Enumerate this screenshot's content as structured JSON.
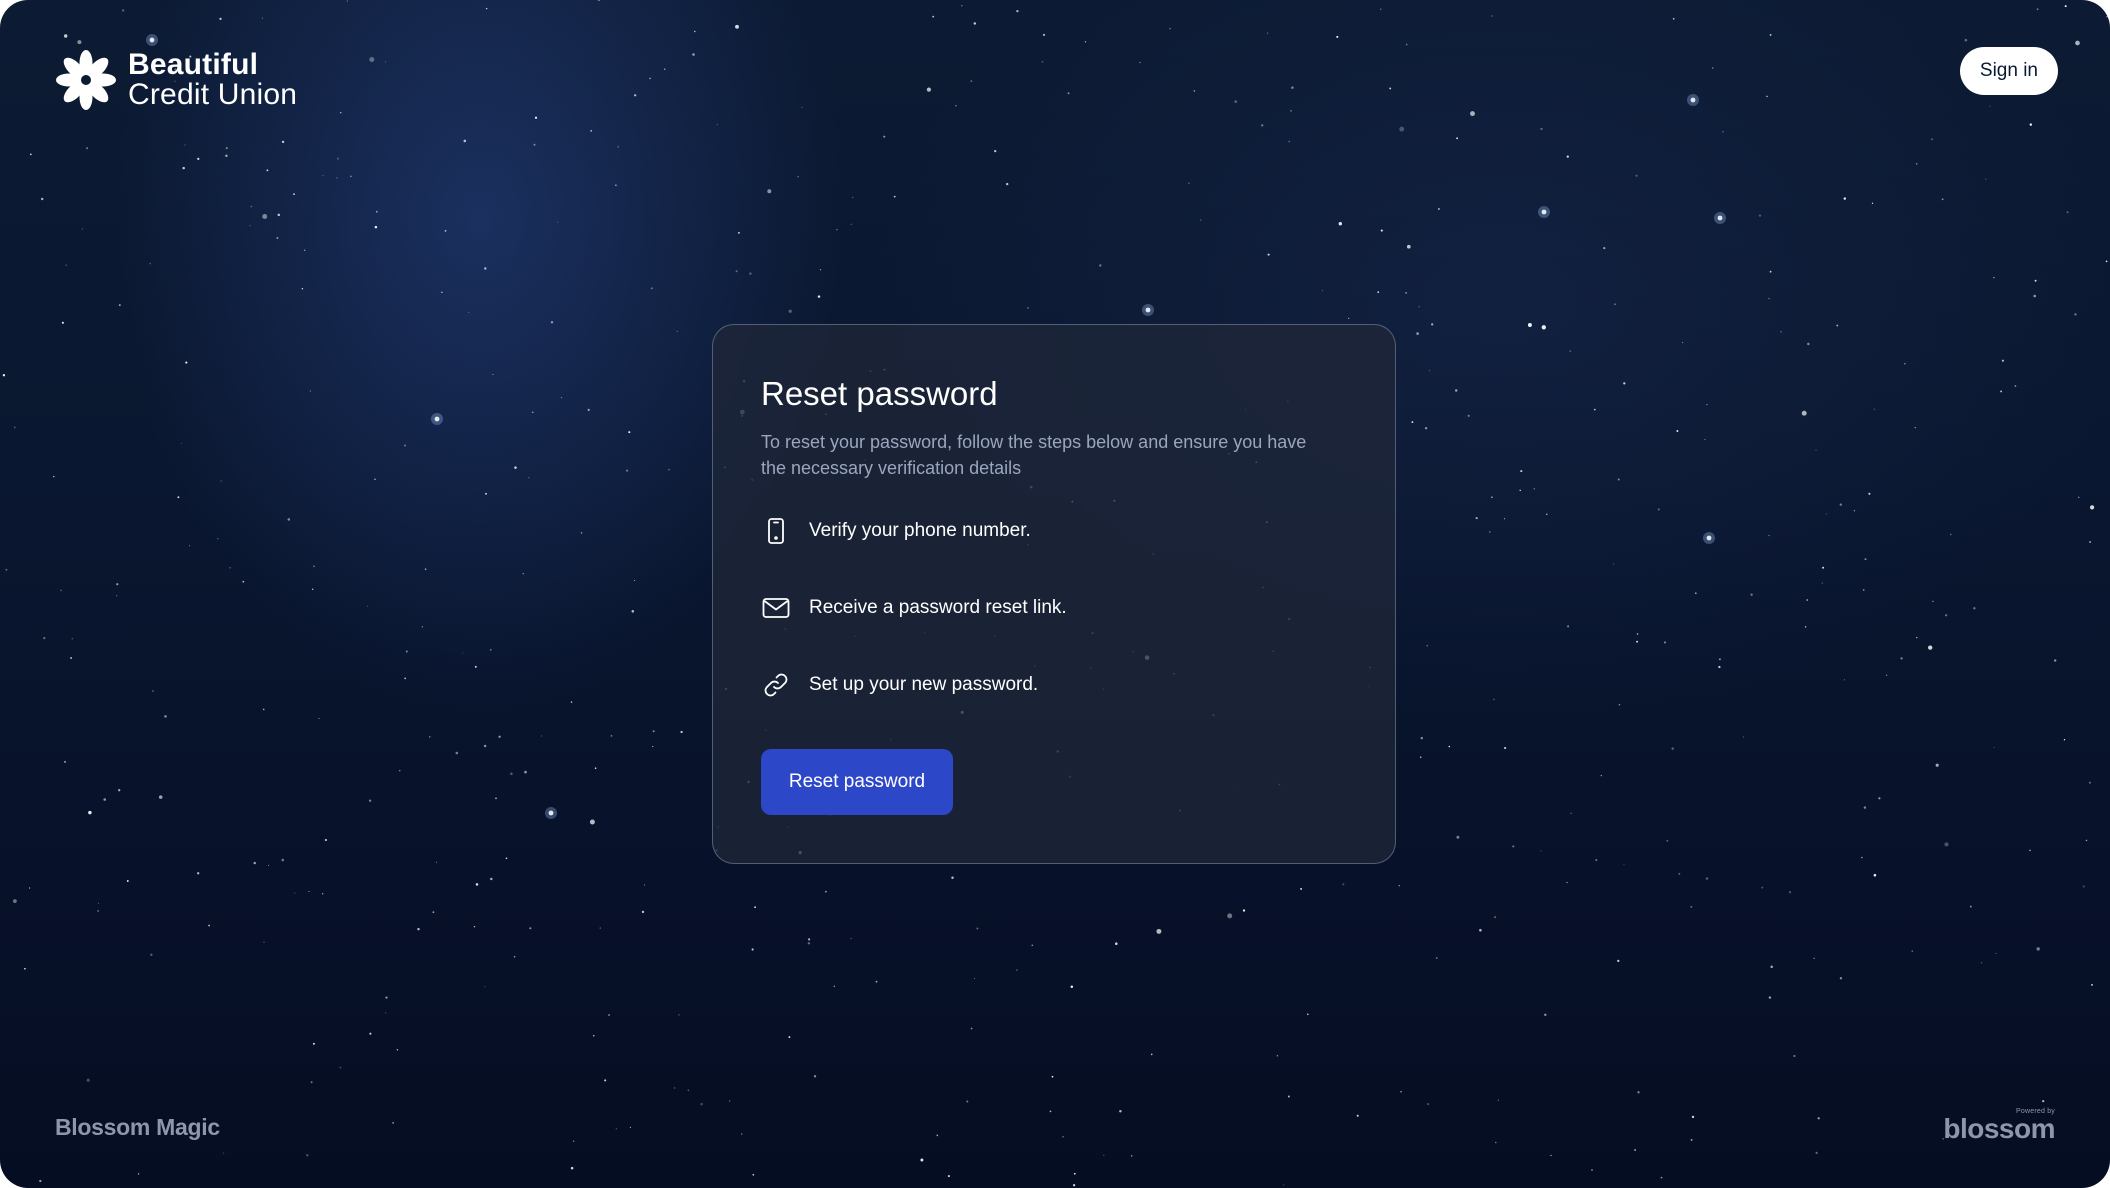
{
  "brand": {
    "name_line1": "Beautiful",
    "name_line2": "Credit Union",
    "logo_icon": "flower-logo-icon"
  },
  "header": {
    "signin_label": "Sign in"
  },
  "card": {
    "title": "Reset password",
    "description": "To reset your password, follow the steps below and ensure you have the necessary verification details",
    "steps": [
      {
        "icon": "phone-icon",
        "label": "Verify your phone number."
      },
      {
        "icon": "mail-icon",
        "label": "Receive a password reset link."
      },
      {
        "icon": "link-icon",
        "label": "Set up your new password."
      }
    ],
    "button_label": "Reset password"
  },
  "footer": {
    "left_text": "Blossom Magic",
    "powered_by": "Powered by",
    "right_brand": "blossom"
  },
  "colors": {
    "background": "#0a1730",
    "card_background": "#1f2738",
    "primary_button": "#2d47c9",
    "muted_text": "#9aa6bd"
  }
}
